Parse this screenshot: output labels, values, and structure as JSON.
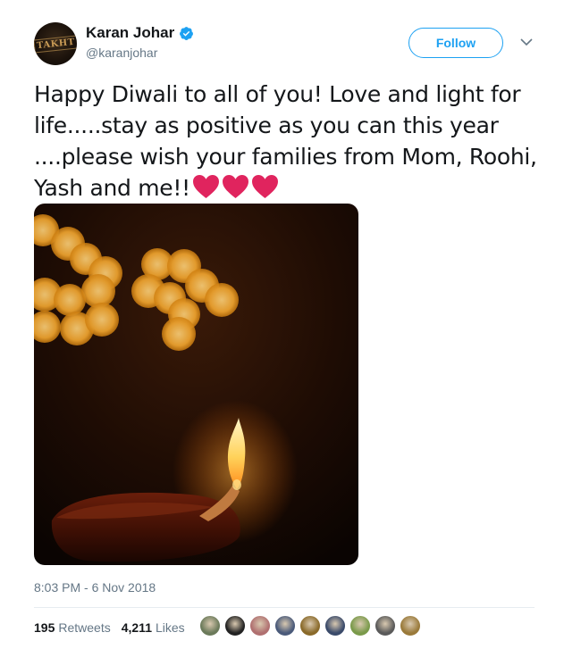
{
  "author": {
    "display_name": "Karan Johar",
    "handle": "@karanjohar",
    "avatar_text": "TAKHT",
    "verified": true
  },
  "follow_button": {
    "label": "Follow"
  },
  "tweet": {
    "text": "Happy Diwali to all of you! Love and light for life.....stay as positive as you can this year ....please wish your families from Mom, Roohi, Yash and me!!",
    "emoji": [
      "red-heart-icon",
      "red-heart-icon",
      "red-heart-icon"
    ],
    "image_alt_icon": "diya-lamp-image"
  },
  "timestamp": "8:03 PM - 6 Nov 2018",
  "stats": {
    "retweets_count": "195",
    "retweets_label": "Retweets",
    "likes_count": "4,211",
    "likes_label": "Likes"
  },
  "likers": [
    {
      "color": "#6b7a5a"
    },
    {
      "color": "#222222"
    },
    {
      "color": "#b07070"
    },
    {
      "color": "#4a5a7a"
    },
    {
      "color": "#8a6a2a"
    },
    {
      "color": "#3a4a6a"
    },
    {
      "color": "#7a9a4a"
    },
    {
      "color": "#5a5a5a"
    },
    {
      "color": "#9a7a3a"
    }
  ],
  "colors": {
    "accent": "#1da1f2",
    "text": "#14171a",
    "secondary": "#657786",
    "heart": "#e0245e"
  }
}
